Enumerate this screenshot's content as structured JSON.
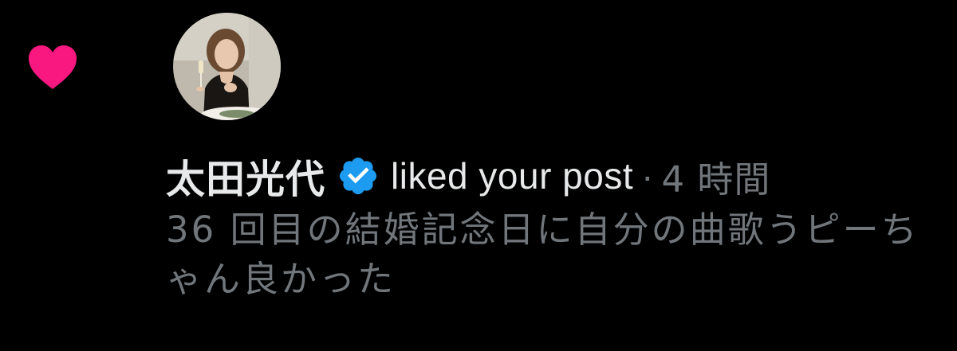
{
  "notification": {
    "icon": "heart-icon",
    "icon_color": "#f91880",
    "user": {
      "name": "太田光代",
      "verified_icon": "verified-badge-icon",
      "verified_color": "#1d9bf0"
    },
    "action": "liked your post",
    "separator": "·",
    "timestamp": "4 時間",
    "post_text": "36 回目の結婚記念日に自分の曲歌うピーちゃん良かった"
  },
  "colors": {
    "background": "#000000",
    "primary_text": "#e7e9ea",
    "secondary_text": "#71767b"
  }
}
